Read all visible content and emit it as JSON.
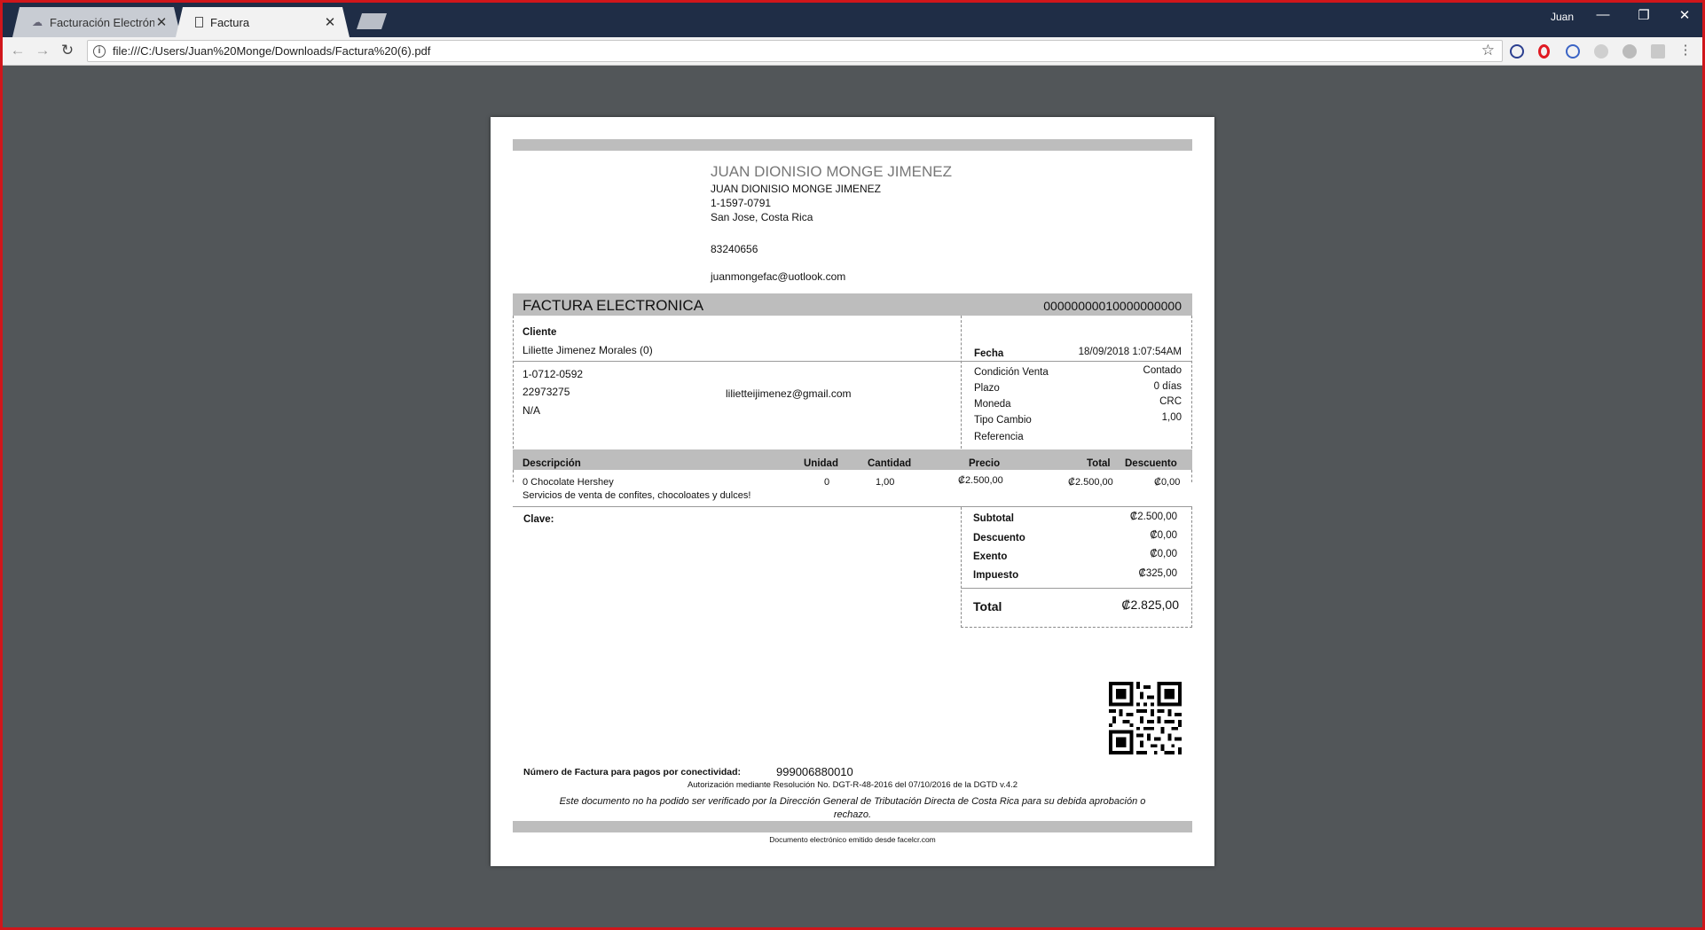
{
  "browser": {
    "tabs": [
      {
        "title": "Facturación Electrónica -",
        "close": "✕"
      },
      {
        "title": "Factura",
        "close": "✕"
      }
    ],
    "user": "Juan",
    "window_buttons": {
      "minimize": "—",
      "restore": "❐",
      "close": "✕"
    },
    "nav": {
      "back": "←",
      "forward": "→",
      "reload": "↻"
    },
    "url": "file:///C:/Users/Juan%20Monge/Downloads/Factura%20(6).pdf",
    "star": "☆",
    "info": "i"
  },
  "invoice": {
    "company_title": "JUAN DIONISIO  MONGE JIMENEZ",
    "company_name": "JUAN DIONISIO  MONGE JIMENEZ",
    "company_id": "1-1597-0791",
    "company_location": "San Jose, Costa Rica",
    "company_phone": "83240656",
    "company_email": "juanmongefac@uotlook.com",
    "doc_type": "FACTURA ELECTRONICA",
    "doc_number": "00000000010000000000",
    "client_label": "Cliente",
    "client_name": "Liliette Jimenez Morales (0)",
    "client_id": "1-0712-0592",
    "client_phone": "22973275",
    "client_email": "lilietteijimenez@gmail.com",
    "client_address": "N/A",
    "fecha_label": "Fecha",
    "fecha_value": "18/09/2018 1:07:54AM",
    "conditions": [
      {
        "label": "Condición Venta",
        "value": "Contado"
      },
      {
        "label": "Plazo",
        "value": "0 días"
      },
      {
        "label": "Moneda",
        "value": "CRC"
      },
      {
        "label": "Tipo Cambio",
        "value": "1,00"
      },
      {
        "label": "Referencia",
        "value": ""
      }
    ],
    "columns": {
      "descripcion": "Descripción",
      "unidad": "Unidad",
      "cantidad": "Cantidad",
      "precio": "Precio",
      "total": "Total",
      "descuento": "Descuento"
    },
    "items": [
      {
        "descripcion": "0 Chocolate Hershey",
        "detalle": "Servicios de venta de confites, chocoloates y dulces!",
        "unidad": "0",
        "cantidad": "1,00",
        "precio": "₡2.500,00",
        "total": "₡2.500,00",
        "descuento": "₡0,00"
      }
    ],
    "clave_label": "Clave:",
    "totals": [
      {
        "label": "Subtotal",
        "value": "₡2.500,00"
      },
      {
        "label": "Descuento",
        "value": "₡0,00"
      },
      {
        "label": "Exento",
        "value": "₡0,00"
      },
      {
        "label": "Impuesto",
        "value": "₡325,00"
      }
    ],
    "total_label": "Total",
    "total_value": "₡2.825,00",
    "conectividad_label": "Número de Factura para pagos por conectividad:",
    "conectividad_value": "999006880010",
    "authorization": "Autorización mediante Resolución No. DGT-R-48-2016 del 07/10/2016 de la DGTD v.4.2",
    "disclaimer_line1": "Este documento no ha podido ser verificado por la Dirección General de Tributación Directa de Costa Rica para su debida aprobación o",
    "disclaimer_line2": "rechazo.",
    "footer": "Documento electrónico emitido desde facelcr.com"
  }
}
